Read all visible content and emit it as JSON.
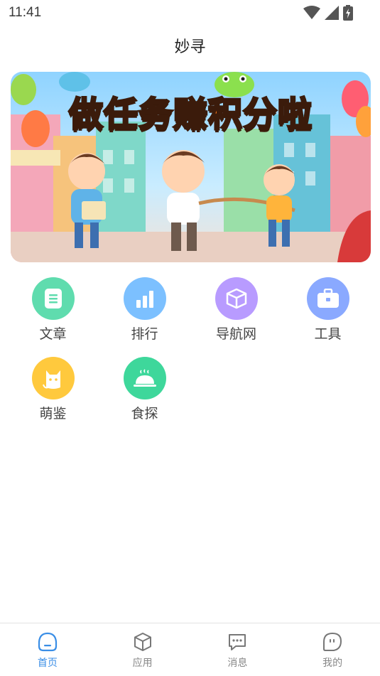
{
  "status": {
    "time": "11:41"
  },
  "header": {
    "title": "妙寻"
  },
  "banner": {
    "headline": "做任务赚积分啦"
  },
  "apps": [
    {
      "label": "文章",
      "icon": "document-icon",
      "color": "#5fdcae"
    },
    {
      "label": "排行",
      "icon": "bar-chart-icon",
      "color": "#7cc0ff"
    },
    {
      "label": "导航网",
      "icon": "cube-icon",
      "color": "#b89bff"
    },
    {
      "label": "工具",
      "icon": "briefcase-icon",
      "color": "#8aa9ff"
    },
    {
      "label": "萌鉴",
      "icon": "cat-icon",
      "color": "#ffc93d"
    },
    {
      "label": "食探",
      "icon": "food-cloche-icon",
      "color": "#3ed79b"
    }
  ],
  "tabbar": {
    "items": [
      {
        "label": "首页",
        "icon": "home-icon",
        "active": true
      },
      {
        "label": "应用",
        "icon": "cube-icon",
        "active": false
      },
      {
        "label": "消息",
        "icon": "message-icon",
        "active": false
      },
      {
        "label": "我的",
        "icon": "profile-icon",
        "active": false
      }
    ],
    "active_color": "#3a8ee6",
    "inactive_color": "#888888"
  }
}
